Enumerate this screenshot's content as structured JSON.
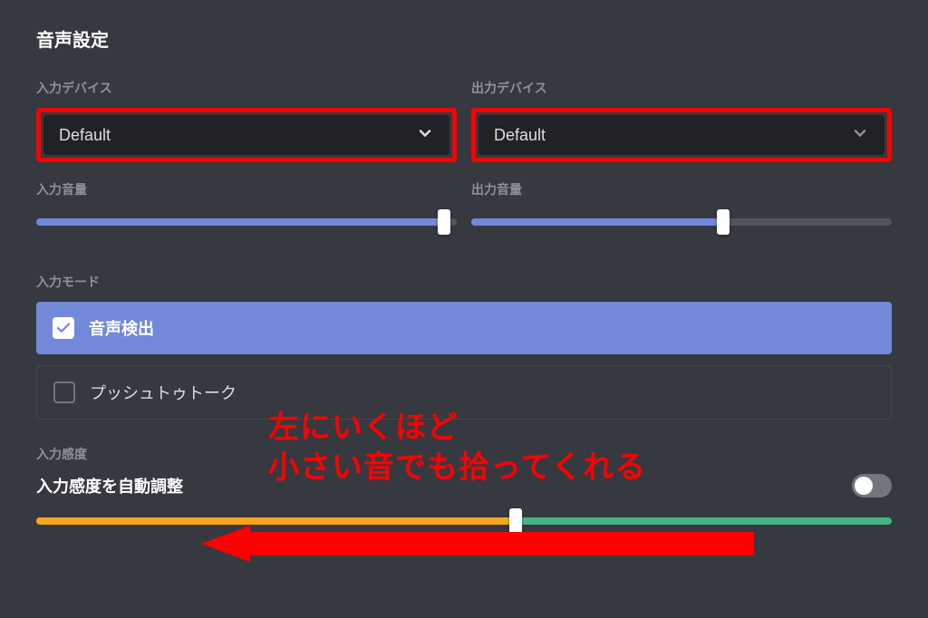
{
  "page": {
    "title": "音声設定"
  },
  "devices": {
    "input_label": "入力デバイス",
    "input_value": "Default",
    "output_label": "出力デバイス",
    "output_value": "Default"
  },
  "volume": {
    "input_label": "入力音量",
    "input_percent": 97,
    "output_label": "出力音量",
    "output_percent": 60
  },
  "mode": {
    "section_label": "入力モード",
    "voice_activity": "音声検出",
    "push_to_talk": "プッシュトゥトーク",
    "selected": "voice_activity"
  },
  "sensitivity": {
    "section_label": "入力感度",
    "auto_label": "入力感度を自動調整",
    "auto_enabled": false,
    "threshold_percent": 56
  },
  "annotation": {
    "line1": "左にいくほど",
    "line2": "小さい音でも拾ってくれる"
  },
  "colors": {
    "accent": "#7289da",
    "highlight": "#ff0000",
    "orange": "#faa61a",
    "green": "#43b581"
  }
}
